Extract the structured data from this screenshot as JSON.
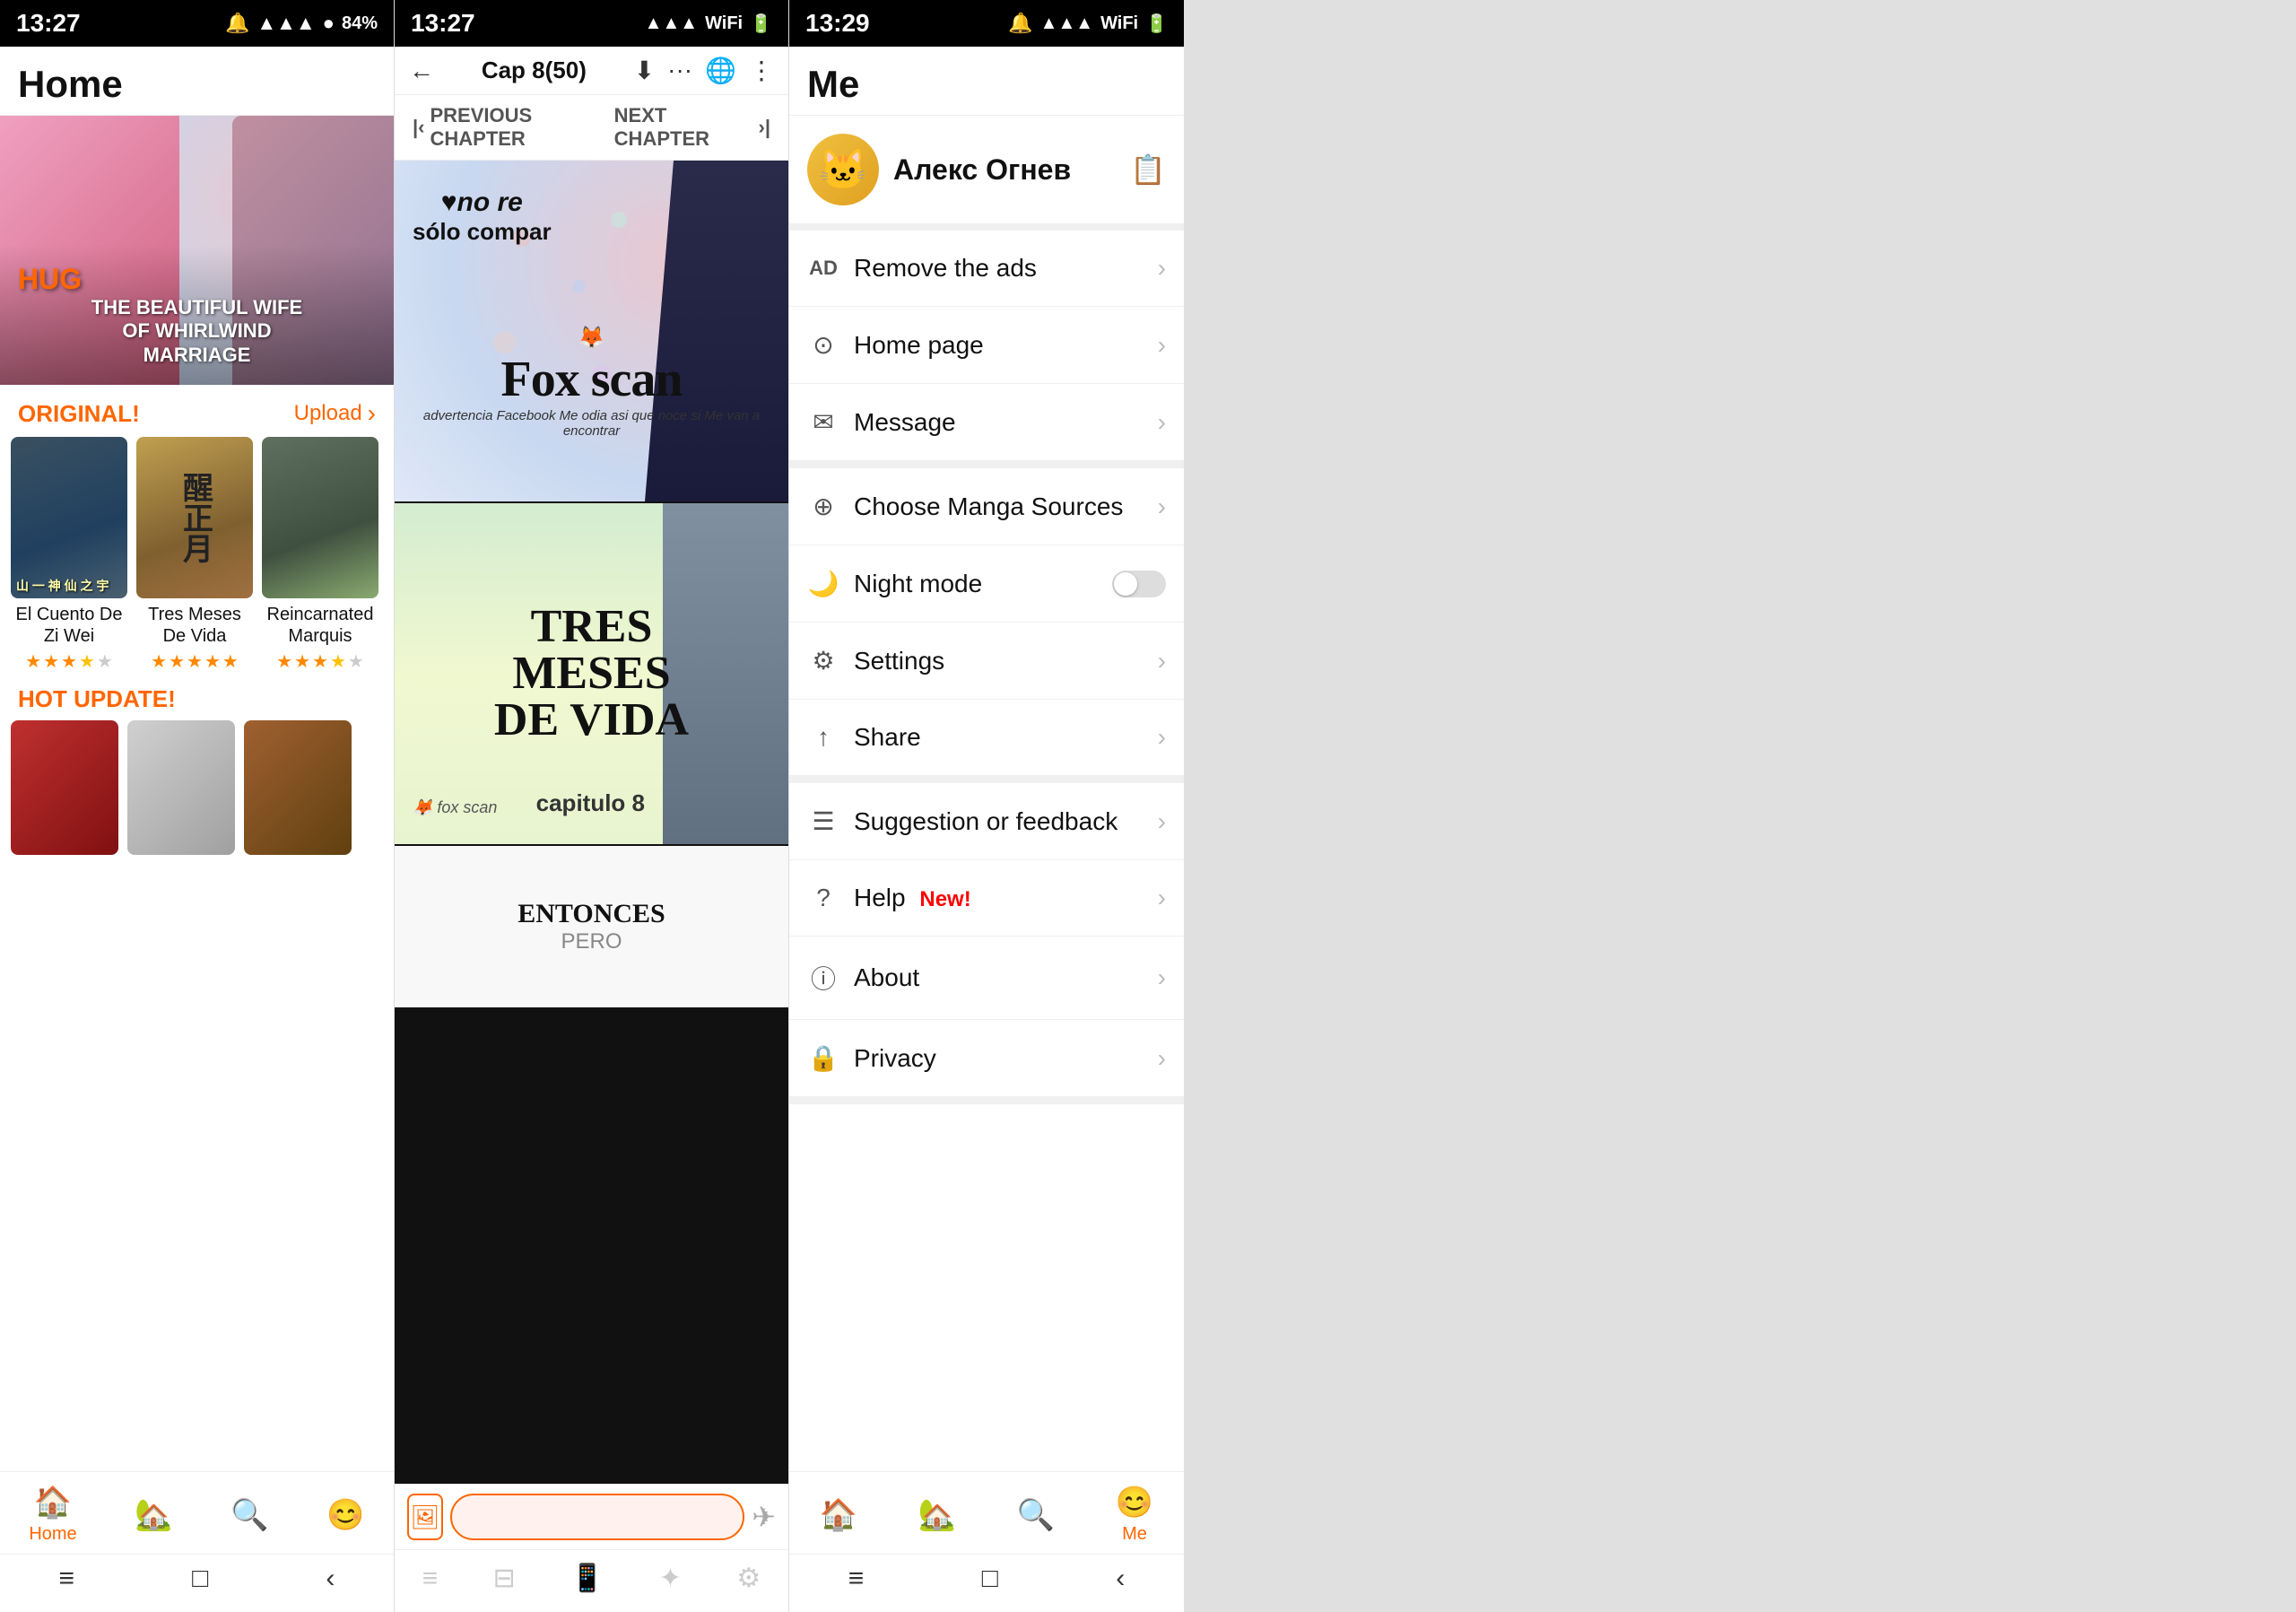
{
  "panel1": {
    "status": {
      "time": "13:27",
      "battery": 84
    },
    "title": "Home",
    "banner": {
      "hug": "HUG",
      "line1": "THE BEAUTIFUL WIFE",
      "line2": "OF WHIRLWIND",
      "line3": "MARRIAGE"
    },
    "section_original": "ORIGINAL!",
    "section_upload": "Upload",
    "manga": [
      {
        "title": "El Cuento De Zi Wei",
        "stars": 3.5
      },
      {
        "title": "Tres Meses De Vida",
        "stars": 5
      },
      {
        "title": "Reincarnated Marquis",
        "stars": 3.5
      }
    ],
    "hot_update": "HOT UPDATE!",
    "nav": [
      {
        "label": "Home",
        "icon": "🏠",
        "active": true
      },
      {
        "label": "",
        "icon": "🏡",
        "active": false
      },
      {
        "label": "",
        "icon": "🔍",
        "active": false
      },
      {
        "label": "",
        "icon": "😊",
        "active": false
      }
    ],
    "sys_nav": [
      "≡",
      "□",
      "‹"
    ]
  },
  "panel2": {
    "status": {
      "time": "13:27"
    },
    "chapter": "Cap 8(50)",
    "prev_chapter": "PREVIOUS CHAPTER",
    "next_chapter": "NEXT CHAPTER",
    "reader_icons": [
      "⬇",
      "···",
      "🌐",
      "⋮"
    ],
    "pages": [
      {
        "text1": "♥no re",
        "text2": "sólo compar",
        "logo": "Fox scan",
        "advert": "advertencia Facebook Me odia asi que noce si Me van a encontrar"
      },
      {
        "text1": "TRES",
        "text2": "MESES",
        "text3": "DE VIDA",
        "capitulo": "capitulo 8"
      }
    ],
    "comment_placeholder": "",
    "sys_nav": [
      "≡",
      "⊟",
      "📱",
      "✦",
      "⚙"
    ]
  },
  "panel3": {
    "status": {
      "time": "13:29"
    },
    "title": "Me",
    "user_name": "Алекс Огнев",
    "menu": [
      {
        "icon": "AD",
        "label": "Remove the ads",
        "type": "arrow"
      },
      {
        "icon": "⊙",
        "label": "Home page",
        "type": "arrow"
      },
      {
        "icon": "✉",
        "label": "Message",
        "type": "arrow"
      },
      {
        "icon": "⊕",
        "label": "Choose Manga Sources",
        "type": "arrow"
      },
      {
        "icon": "🌙",
        "label": "Night mode",
        "type": "toggle",
        "value": false
      },
      {
        "icon": "⚙",
        "label": "Settings",
        "type": "arrow"
      },
      {
        "icon": "↑",
        "label": "Share",
        "type": "arrow"
      },
      {
        "icon": "☰",
        "label": "Suggestion or feedback",
        "type": "arrow"
      },
      {
        "icon": "?",
        "label": "Help",
        "badge": "New!",
        "type": "arrow"
      },
      {
        "icon": "ⓘ",
        "label": "About",
        "type": "arrow"
      },
      {
        "icon": "🔒",
        "label": "Privacy",
        "type": "arrow"
      }
    ],
    "nav": [
      {
        "label": "",
        "icon": "🏠",
        "active": false
      },
      {
        "label": "",
        "icon": "🏡",
        "active": false
      },
      {
        "label": "",
        "icon": "🔍",
        "active": false
      },
      {
        "label": "Me",
        "icon": "😊",
        "active": true
      }
    ],
    "sys_nav": [
      "≡",
      "□",
      "‹"
    ]
  }
}
